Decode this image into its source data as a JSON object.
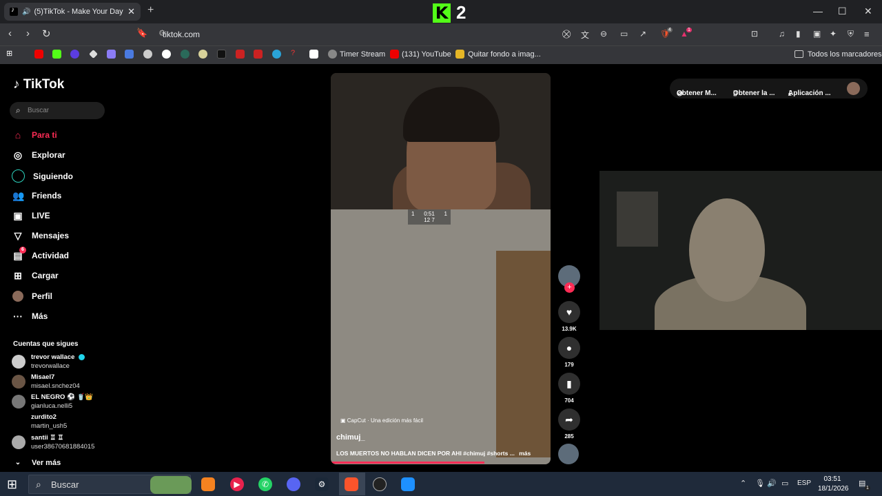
{
  "browser": {
    "tab_title": "(5)TikTok - Make Your Day",
    "url": "tiktok.com",
    "k2_label": "2",
    "bookmarks": [
      {
        "label": "Timer Stream"
      },
      {
        "label": "(131) YouTube"
      },
      {
        "label": "Quitar fondo a imag..."
      }
    ],
    "all_bookmarks": "Todos los marcadores",
    "brave_badge": "4",
    "alert_badge": "1"
  },
  "sidebar": {
    "logo": "TikTok",
    "search_placeholder": "Buscar",
    "items": [
      {
        "label": "Para ti"
      },
      {
        "label": "Explorar"
      },
      {
        "label": "Siguiendo"
      },
      {
        "label": "Friends"
      },
      {
        "label": "LIVE"
      },
      {
        "label": "Mensajes"
      },
      {
        "label": "Actividad"
      },
      {
        "label": "Cargar"
      },
      {
        "label": "Perfil"
      },
      {
        "label": "Más"
      }
    ],
    "activity_badge": "6",
    "following_title": "Cuentas que sigues",
    "following": [
      {
        "name": "trevor wallace",
        "handle": "trevorwallace"
      },
      {
        "name": "Misael7",
        "handle": "misael.snchez04"
      },
      {
        "name": "EL NEGRO ⚽ 🥤👑",
        "handle": "gianluca.nelli5"
      },
      {
        "name": "zurdito2",
        "handle": "martin_ush5"
      },
      {
        "name": "santii ♖ ♖",
        "handle": "user38670681884015"
      }
    ],
    "see_more": "Ver más"
  },
  "video": {
    "hud_time": "0:51",
    "hud_left": "1",
    "hud_right": "1",
    "hud_score": "12  7",
    "capcut": "CapCut · Una edición más fácil",
    "author": "chimuj_",
    "description": "LOS MUERTOS NO HABLAN DICEN POR AHI #chimuj #shorts ...",
    "more": "más",
    "progress": 0.7,
    "likes": "13.9K",
    "comments": "179",
    "saves": "704",
    "shares": "285"
  },
  "top_right": {
    "get_coins": "Obtener M...",
    "get_app": "Obtener la ...",
    "app": "Aplicación ..."
  },
  "taskbar": {
    "search": "Buscar",
    "lang": "ESP",
    "time": "03:51",
    "date": "18/1/2026",
    "notif_count": "1"
  }
}
